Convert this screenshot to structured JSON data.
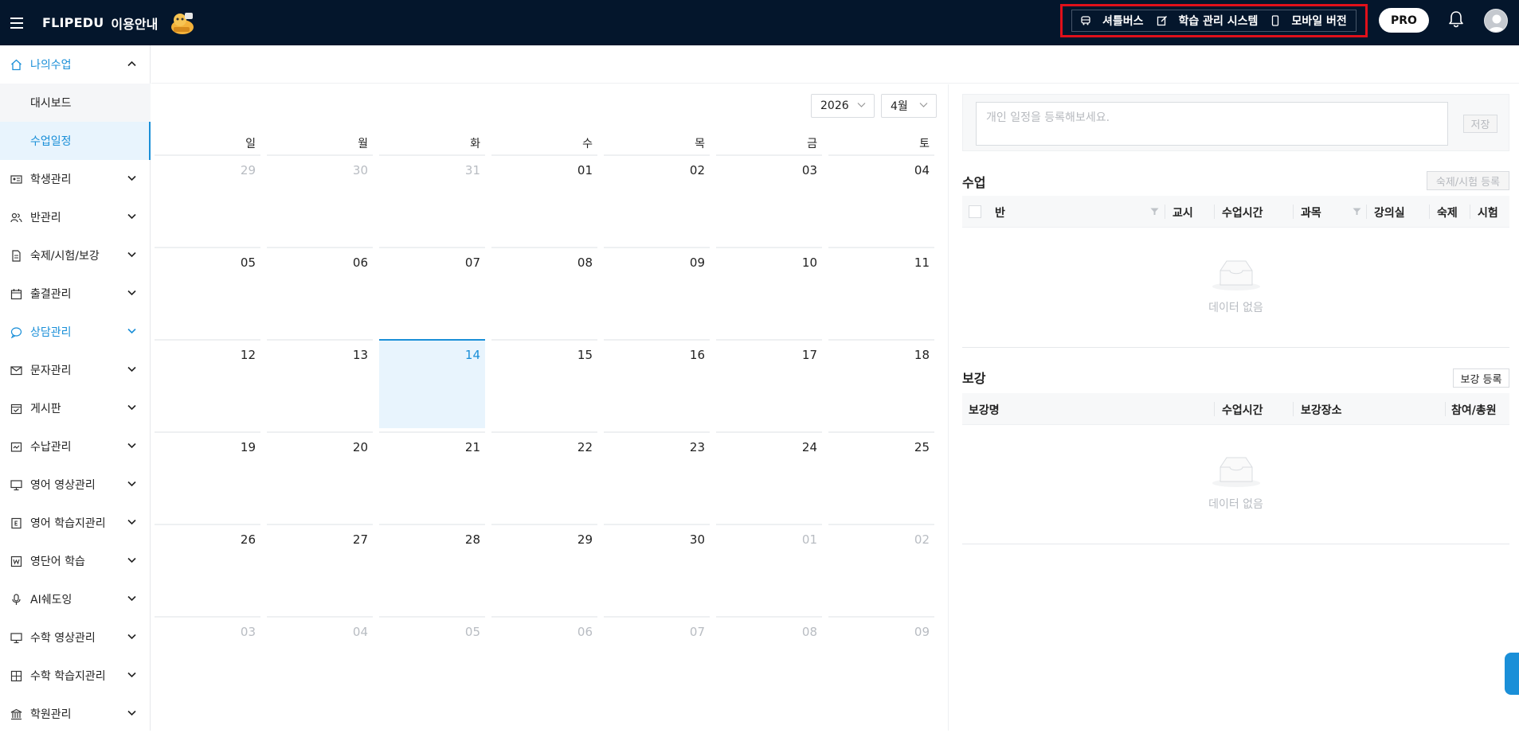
{
  "header": {
    "brand": "FLIPEDU",
    "brand_sub": "이용안내",
    "quicklinks": [
      {
        "label": "셔틀버스",
        "icon": "bus-icon"
      },
      {
        "label": "학습 관리 시스템",
        "icon": "edit-icon"
      },
      {
        "label": "모바일 버전",
        "icon": "mobile-icon"
      }
    ],
    "pro_label": "PRO"
  },
  "sidebar": {
    "items": [
      {
        "label": "나의수업",
        "icon": "home-icon"
      },
      {
        "label": "대시보드"
      },
      {
        "label": "수업일정"
      },
      {
        "label": "학생관리",
        "icon": "id-card-icon"
      },
      {
        "label": "반관리",
        "icon": "users-icon"
      },
      {
        "label": "숙제/시험/보강",
        "icon": "document-icon"
      },
      {
        "label": "출결관리",
        "icon": "calendar-icon"
      },
      {
        "label": "상담관리",
        "icon": "chat-icon"
      },
      {
        "label": "문자관리",
        "icon": "mail-icon"
      },
      {
        "label": "게시판",
        "icon": "board-icon"
      },
      {
        "label": "수납관리",
        "icon": "wallet-icon"
      },
      {
        "label": "영어 영상관리",
        "icon": "monitor-icon"
      },
      {
        "label": "영어 학습지관리",
        "icon": "english-book-icon"
      },
      {
        "label": "영단어 학습",
        "icon": "word-icon"
      },
      {
        "label": "AI쉐도잉",
        "icon": "microphone-icon"
      },
      {
        "label": "수학 영상관리",
        "icon": "monitor-icon"
      },
      {
        "label": "수학 학습지관리",
        "icon": "calculator-icon"
      },
      {
        "label": "학원관리",
        "icon": "building-icon"
      }
    ]
  },
  "calendar": {
    "year": "2026",
    "month": "4월",
    "weekdays": [
      "일",
      "월",
      "화",
      "수",
      "목",
      "금",
      "토"
    ],
    "weeks": [
      [
        {
          "d": "29",
          "m": true
        },
        {
          "d": "30",
          "m": true
        },
        {
          "d": "31",
          "m": true
        },
        {
          "d": "01"
        },
        {
          "d": "02"
        },
        {
          "d": "03"
        },
        {
          "d": "04"
        }
      ],
      [
        {
          "d": "05"
        },
        {
          "d": "06"
        },
        {
          "d": "07"
        },
        {
          "d": "08"
        },
        {
          "d": "09"
        },
        {
          "d": "10"
        },
        {
          "d": "11"
        }
      ],
      [
        {
          "d": "12"
        },
        {
          "d": "13"
        },
        {
          "d": "14",
          "today": true
        },
        {
          "d": "15"
        },
        {
          "d": "16"
        },
        {
          "d": "17"
        },
        {
          "d": "18"
        }
      ],
      [
        {
          "d": "19"
        },
        {
          "d": "20"
        },
        {
          "d": "21"
        },
        {
          "d": "22"
        },
        {
          "d": "23"
        },
        {
          "d": "24"
        },
        {
          "d": "25"
        }
      ],
      [
        {
          "d": "26"
        },
        {
          "d": "27"
        },
        {
          "d": "28"
        },
        {
          "d": "29"
        },
        {
          "d": "30"
        },
        {
          "d": "01",
          "m": true
        },
        {
          "d": "02",
          "m": true
        }
      ],
      [
        {
          "d": "03",
          "m": true
        },
        {
          "d": "04",
          "m": true
        },
        {
          "d": "05",
          "m": true
        },
        {
          "d": "06",
          "m": true
        },
        {
          "d": "07",
          "m": true
        },
        {
          "d": "08",
          "m": true
        },
        {
          "d": "09",
          "m": true
        }
      ]
    ]
  },
  "memo": {
    "placeholder": "개인 일정을 등록해보세요.",
    "save_label": "저장"
  },
  "classes": {
    "title": "수업",
    "register_label": "숙제/시험 등록",
    "columns": [
      "반",
      "교시",
      "수업시간",
      "과목",
      "강의실",
      "숙제",
      "시험"
    ],
    "empty_text": "데이터 없음"
  },
  "makeup": {
    "title": "보강",
    "register_label": "보강 등록",
    "columns": [
      "보강명",
      "수업시간",
      "보강장소",
      "참여/총원"
    ],
    "empty_text": "데이터 없음"
  },
  "colors": {
    "topbar": "#04162c",
    "accent": "#1a8fd8",
    "highlight_border": "#e0101a"
  }
}
